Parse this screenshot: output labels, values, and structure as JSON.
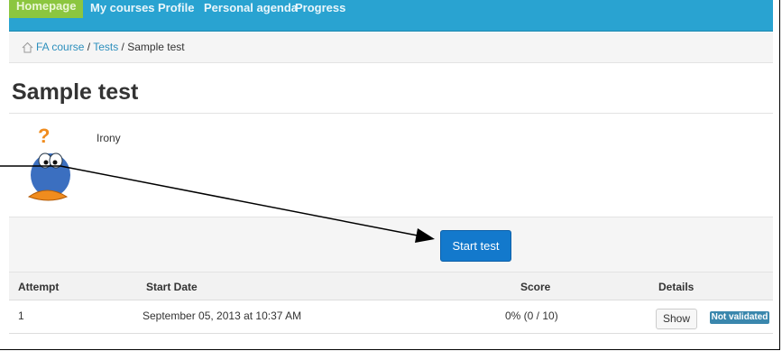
{
  "nav": {
    "items": [
      "Homepage",
      "My courses",
      "Profile",
      "Personal agenda",
      "Progress"
    ]
  },
  "breadcrumb": {
    "course": "FA course",
    "separator": "/",
    "tests": "Tests",
    "current": "Sample test"
  },
  "page": {
    "title": "Sample test",
    "description": "Irony"
  },
  "start_button": "Start test",
  "table": {
    "headers": [
      "Attempt",
      "Start Date",
      "Score",
      "Details"
    ],
    "rows": [
      {
        "attempt": "1",
        "start_date": "September 05, 2013 at 10:37 AM",
        "score": "0% (0 / 10)",
        "show": "Show",
        "status": "Not validated"
      }
    ]
  },
  "colors": {
    "nav_bg": "#29a3d1",
    "nav_active": "#8cc63f",
    "primary_button": "#1379cc",
    "badge": "#3a87ad"
  },
  "icons": [
    "home-icon",
    "question-mascot-icon",
    "annotation-arrow"
  ]
}
